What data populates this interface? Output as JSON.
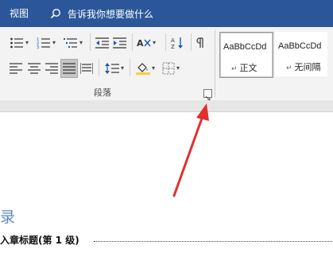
{
  "titlebar": {
    "view_tab": "视图",
    "search_placeholder": "告诉我你想要做什么"
  },
  "ribbon": {
    "group_label": "段落",
    "styles": [
      {
        "sample": "AaBbCcDd",
        "name": "正文",
        "selected": true
      },
      {
        "sample": "AaBbCcDd",
        "name": "无间隔",
        "selected": false
      }
    ]
  },
  "document": {
    "title": "录",
    "toc_entry": "入章标题(第 1 级)"
  },
  "annotation": {
    "arrow_color": "#e0312d"
  },
  "colors": {
    "titlebar": "#2b579a",
    "ribbon": "#f3f3f3",
    "heading": "#5b87c5"
  }
}
